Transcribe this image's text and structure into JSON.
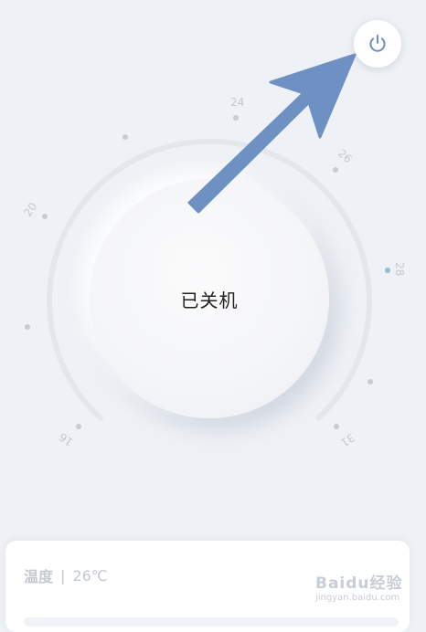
{
  "status_label": "已关机",
  "dial": {
    "ticks": [
      "20",
      "24",
      "26",
      "28",
      "16",
      "31"
    ]
  },
  "panel": {
    "temp_label": "温度",
    "separator": "|",
    "temp_value": "26℃"
  },
  "watermark": {
    "text": "Baidu经验",
    "url": "jingyan.baidu.com"
  },
  "colors": {
    "background": "#eef1f5",
    "power_icon": "#6b8cbf",
    "arrow": "#6f90c2",
    "tick_dot": "#c7ccd4",
    "tick_dot_accent": "#8fc3c7"
  },
  "icons": {
    "power": "power-icon",
    "arrow": "pointer-arrow"
  }
}
